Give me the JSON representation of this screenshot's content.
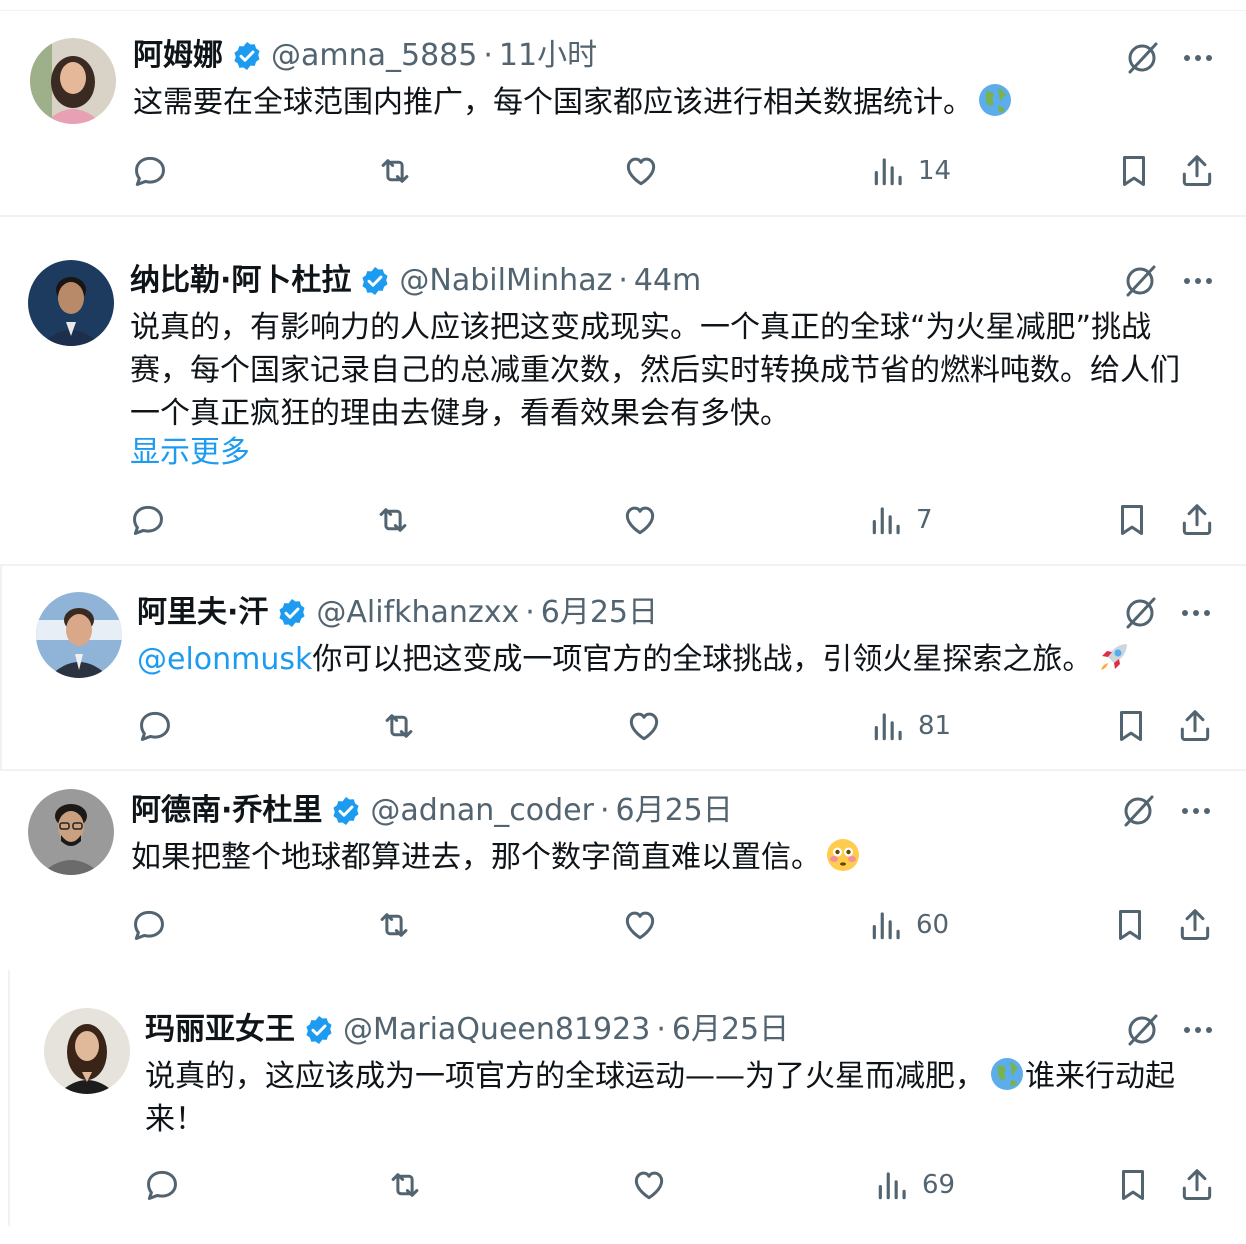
{
  "tweets": [
    {
      "name": "阿姆娜",
      "handle": "@amna_5885",
      "separator": "·",
      "time": "11小时",
      "text": "这需要在全球范围内推广，每个国家都应该进行相关数据统计。",
      "emoji": "globe-emoji",
      "views": "14",
      "avatar_colors": {
        "bg": "#d9d2c6",
        "hair": "#3a2a22",
        "skin": "#e6b89a",
        "shirt": "#e7a0b4"
      }
    },
    {
      "name": "纳比勒·阿卜杜拉",
      "handle": "@NabilMinhaz",
      "separator": "·",
      "time": "44m",
      "text": "说真的，有影响力的人应该把这变成现实。一个真正的全球“为火星减肥”挑战赛，每个国家记录自己的总减重次数，然后实时转换成节省的燃料吨数。给人们一个真正疯狂的理由去健身，看看效果会有多快。",
      "show_more": "显示更多",
      "views": "7",
      "avatar_colors": {
        "bg": "#1d3a5f",
        "hair": "#1a1412",
        "skin": "#b98a6a",
        "shirt": "#1e2f4d"
      }
    },
    {
      "name": "阿里夫·汗",
      "handle": "@Alifkhanzxx",
      "separator": "·",
      "time": "6月25日",
      "mention": "@elonmusk",
      "text": "你可以把这变成一项官方的全球挑战，引领火星探索之旅。",
      "emoji": "rocket-emoji",
      "views": "81",
      "avatar_colors": {
        "bg": "#8fb4d8",
        "hair": "#3b2a20",
        "skin": "#d9a888",
        "shirt": "#2b3240"
      }
    },
    {
      "name": "阿德南·乔杜里",
      "handle": "@adnan_coder",
      "separator": "·",
      "time": "6月25日",
      "text": "如果把整个地球都算进去，那个数字简直难以置信。",
      "emoji": "flushed-face-emoji",
      "views": "60",
      "avatar_colors": {
        "bg": "#9a9a9a",
        "hair": "#1c1a18",
        "skin": "#c9a080",
        "shirt": "#6b6b6b"
      }
    },
    {
      "name": "玛丽亚女王",
      "handle": "@MariaQueen81923",
      "separator": "·",
      "time": "6月25日",
      "text": "说真的，这应该成为一项官方的全球运动——为了火星而减肥，",
      "emoji": "globe-emoji",
      "text_after": "谁来行动起来！",
      "views": "69",
      "avatar_colors": {
        "bg": "#e6e2dc",
        "hair": "#3a2418",
        "skin": "#e0b89a",
        "shirt": "#1c1c1c"
      }
    }
  ],
  "colors": {
    "accent": "#1d9bf0",
    "secondary": "#536471",
    "text": "#0f1419",
    "divider": "#eff3f4"
  }
}
